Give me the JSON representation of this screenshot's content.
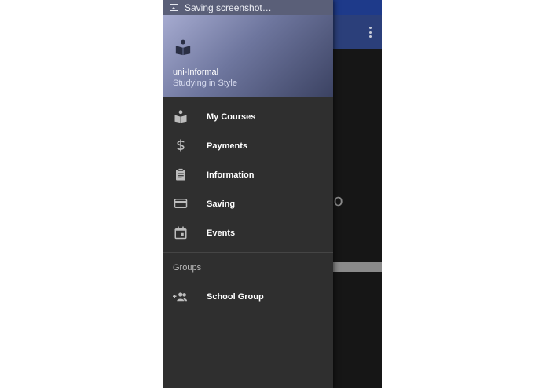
{
  "status_bar": {
    "text": "Saving screenshot…",
    "icon": "image-icon"
  },
  "background_app": {
    "partial_text": "zo",
    "menu_icon": "more-vert-icon"
  },
  "drawer": {
    "header": {
      "logo_icon": "book-reader-icon",
      "title": "uni-Informal",
      "subtitle": "Studying in Style"
    },
    "items": [
      {
        "label": "My Courses",
        "icon": "book-reader-icon"
      },
      {
        "label": "Payments",
        "icon": "dollar-icon"
      },
      {
        "label": "Information",
        "icon": "clipboard-icon"
      },
      {
        "label": "Saving",
        "icon": "credit-card-icon"
      },
      {
        "label": "Events",
        "icon": "calendar-icon"
      }
    ],
    "groups_header": "Groups",
    "groups": [
      {
        "label": "School Group",
        "icon": "group-add-icon"
      }
    ]
  },
  "colors": {
    "drawer_bg": "#2f2f2f",
    "icon": "#bdbdbd",
    "text": "#ffffff",
    "app_bar": "#2b3f7a"
  }
}
